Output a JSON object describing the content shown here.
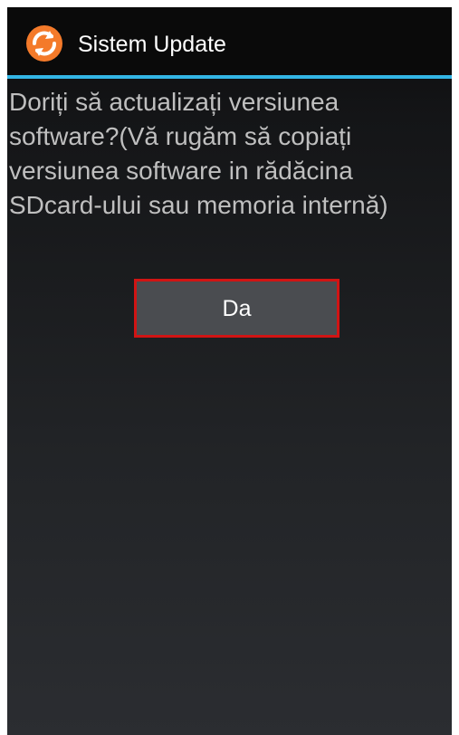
{
  "app": {
    "title": "Sistem Update",
    "icon": "sync-refresh-icon",
    "accent_color": "#33b5e5",
    "icon_color": "#f47a2a"
  },
  "dialog": {
    "message": "Doriți să actualizați versiunea software?(Vă rugăm să copiați versiunea software in rădăcina SDcard-ului sau memoria internă)",
    "confirm_label": "Da",
    "button_border_color": "#d11414"
  }
}
